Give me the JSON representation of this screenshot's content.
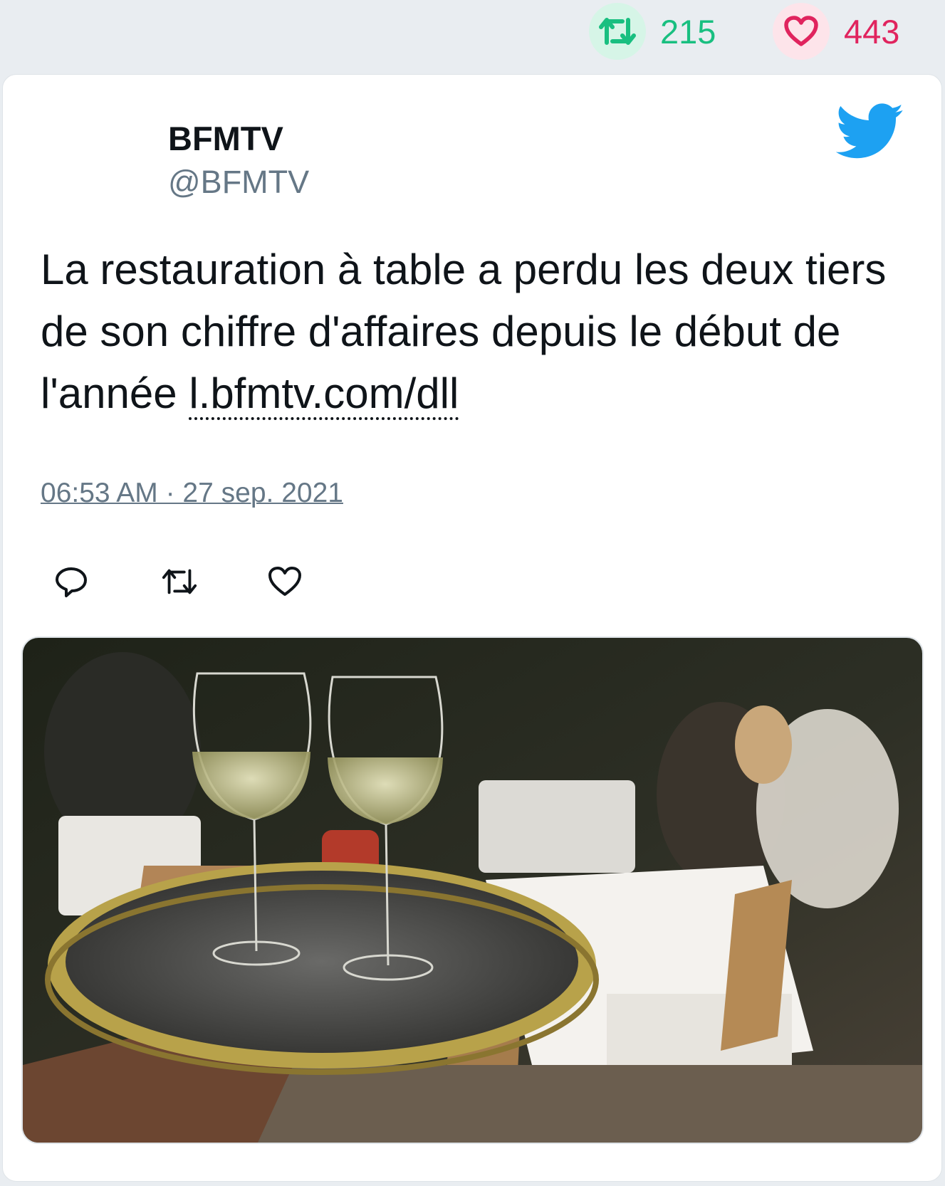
{
  "stats": {
    "retweet_count": "215",
    "like_count": "443"
  },
  "tweet": {
    "author_name": "BFMTV",
    "author_handle": "@BFMTV",
    "text": "La restauration à table a perdu les deux tiers de son chiffre d'affaires depuis le début de l'année ",
    "link_text": "l.bfmtv.com/dll",
    "timestamp": "06:53 AM · 27 sep. 2021"
  },
  "icons": {
    "retweet": "retweet-icon",
    "like": "heart-icon",
    "reply": "reply-icon",
    "brand": "twitter-bird-icon"
  },
  "colors": {
    "retweet_green": "#19bf80",
    "like_red": "#e0245e",
    "twitter_blue": "#1da1f2",
    "muted": "#657786"
  }
}
